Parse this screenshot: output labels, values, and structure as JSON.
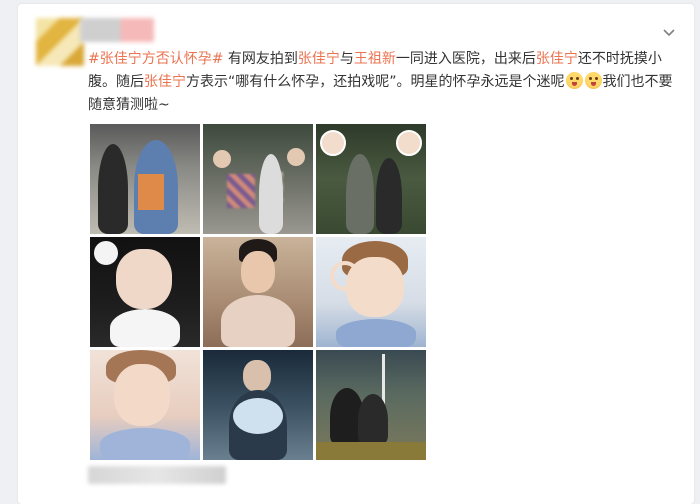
{
  "post": {
    "hashtag": "#张佳宁方否认怀孕#",
    "seg1": " 有网友拍到",
    "name1": "张佳宁",
    "seg2": "与",
    "name2": "王祖新",
    "seg3": "一同进入医院，出来后",
    "name3": "张佳宁",
    "seg4": "还不时抚摸小腹。随后",
    "name4": "张佳宁",
    "seg5": "方表示“哪有什么怀孕，还拍戏呢”。明星的怀孕永远是个迷呢",
    "seg6": "我们也不要随意猜测啦~"
  },
  "icons": {
    "menu": "chevron-down-icon",
    "emoji": "smile-emoji-icon"
  },
  "colors": {
    "link": "#eb7350",
    "text": "#333333",
    "background": "#eef0f3"
  }
}
